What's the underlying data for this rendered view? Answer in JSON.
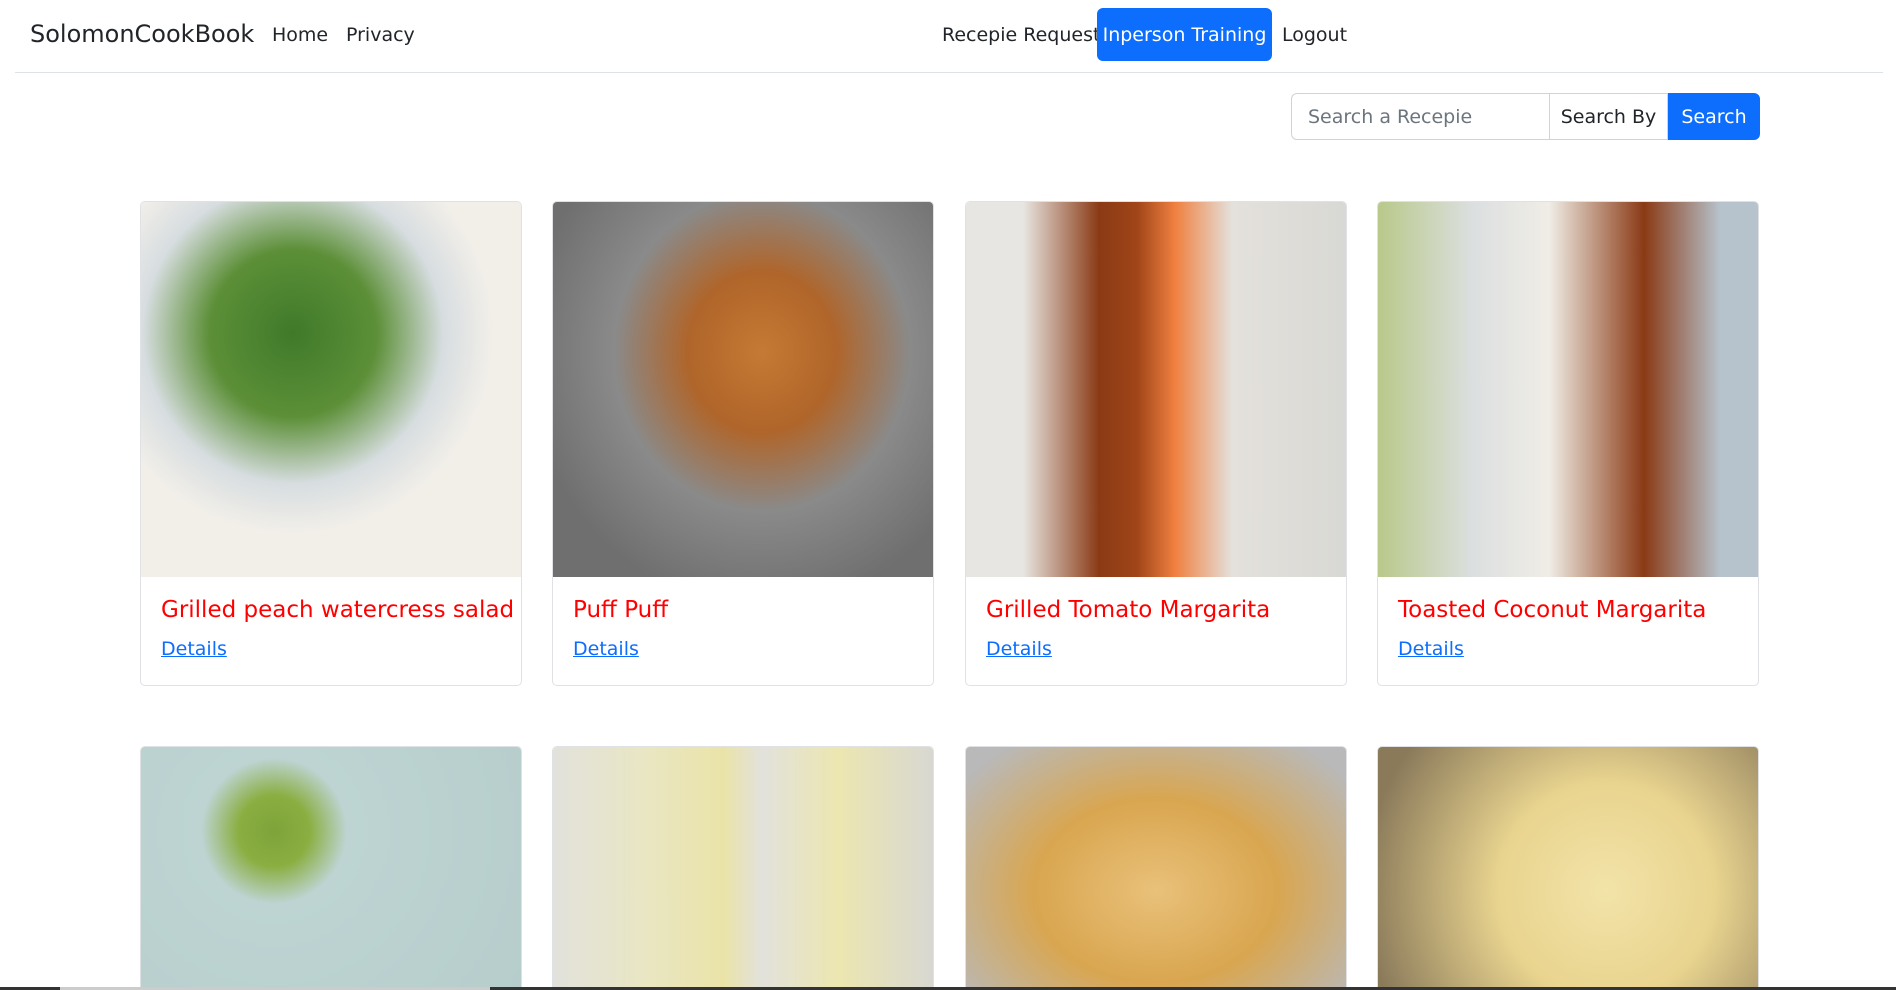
{
  "nav": {
    "brand": "SolomonCookBook",
    "home": "Home",
    "privacy": "Privacy",
    "request": "Recepie Request",
    "training": "Inperson Training",
    "logout": "Logout"
  },
  "search": {
    "placeholder": "Search a Recepie",
    "search_by": "Search By",
    "button": "Search"
  },
  "recipes": [
    {
      "title": "Grilled peach watercress salad",
      "link": "Details"
    },
    {
      "title": "Puff Puff",
      "link": "Details"
    },
    {
      "title": "Grilled Tomato Margarita",
      "link": "Details"
    },
    {
      "title": "Toasted Coconut Margarita",
      "link": "Details"
    }
  ]
}
